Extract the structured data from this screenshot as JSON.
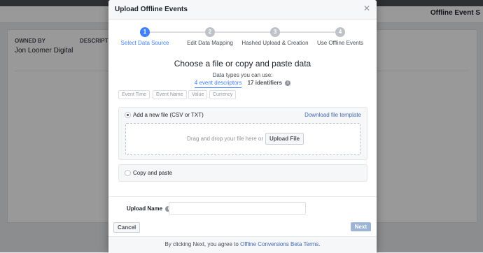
{
  "background": {
    "header_title": "Offline Event S",
    "owned_by_label": "OWNED BY",
    "description_label": "DESCRIPTIO",
    "owner_name": "Jon Loomer Digital"
  },
  "modal": {
    "title": "Upload Offline Events",
    "close_icon": "close-icon",
    "steps": [
      {
        "number": "1",
        "label": "Select Data Source",
        "active": true
      },
      {
        "number": "2",
        "label": "Edit Data Mapping",
        "active": false
      },
      {
        "number": "3",
        "label": "Hashed Upload & Creation",
        "active": false
      },
      {
        "number": "4",
        "label": "Use Offline Events",
        "active": false
      }
    ],
    "main_title": "Choose a file or copy and paste data",
    "types_caption": "Data types you can use:",
    "event_descriptors_link": "4 event descriptors",
    "identifiers_link": "17 identifiers",
    "descriptor_pills": [
      "Event Time",
      "Event Name",
      "Value",
      "Currency"
    ],
    "file_option_label": "Add a new file (CSV or TXT)",
    "download_template_link": "Download file template",
    "dropzone_text": "Drag and drop your file here or",
    "upload_button_label": "Upload File",
    "paste_option_label": "Copy and paste",
    "upload_name_label": "Upload Name",
    "upload_name_value": "",
    "cancel_label": "Cancel",
    "next_label": "Next",
    "terms_prefix": "By clicking Next, you agree to",
    "terms_link": "Offline Conversions Beta Terms",
    "terms_suffix": "."
  },
  "colors": {
    "accent": "#4080ff",
    "link": "#4267b2",
    "next_disabled": "#9cb4d8"
  }
}
